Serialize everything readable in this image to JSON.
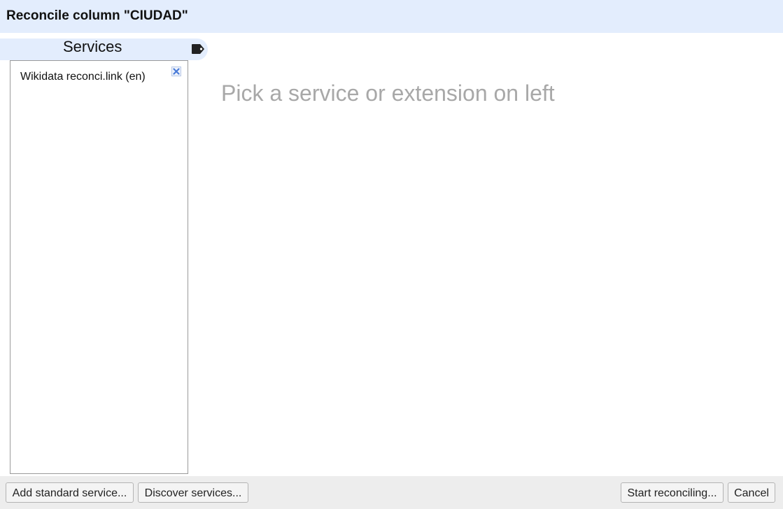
{
  "dialog": {
    "title": "Reconcile column \"CIUDAD\""
  },
  "services_panel": {
    "tab_label": "Services",
    "tab_icon": "tag-icon",
    "items": [
      {
        "label": "Wikidata reconci.link (en)",
        "remove_icon": "close-icon"
      }
    ]
  },
  "main": {
    "placeholder": "Pick a service or extension on left"
  },
  "footer": {
    "add_standard_service_label": "Add standard service...",
    "discover_services_label": "Discover services...",
    "start_reconciling_label": "Start reconciling...",
    "cancel_label": "Cancel"
  },
  "colors": {
    "header_bg": "#e3edfd",
    "footer_bg": "#ededed",
    "placeholder_text": "#a8a8a8",
    "remove_icon_accent": "#4a7bd8"
  }
}
